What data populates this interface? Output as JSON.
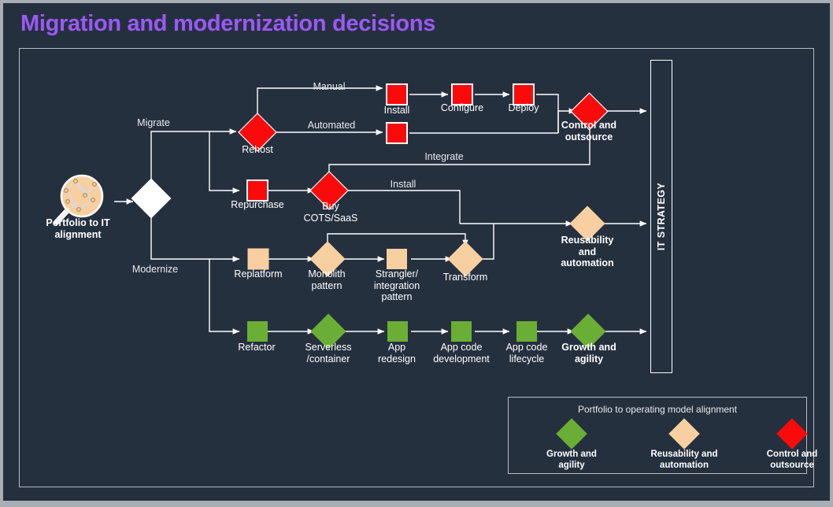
{
  "title": "Migration and modernization decisions",
  "colors": {
    "background": "#25303f",
    "page_border": "#a9adb4",
    "title": "#9b59f5",
    "red": "#fa0a0a",
    "green": "#6aae35",
    "peach": "#f8cfa1",
    "white": "#ffffff",
    "line": "#c9ccd1"
  },
  "start": {
    "icon": "magnifier-portfolio-icon",
    "label": "Portfolio to IT\nalignment"
  },
  "decision": {
    "name": "root-decision-diamond"
  },
  "edge_labels": {
    "migrate": "Migrate",
    "modernize": "Modernize",
    "manual": "Manual",
    "automated": "Automated",
    "integrate": "Integrate",
    "install_cots": "Install"
  },
  "nodes": {
    "rehost": {
      "label": "Rehost",
      "shape": "diamond",
      "color": "red"
    },
    "install": {
      "label": "Install",
      "shape": "square",
      "color": "red"
    },
    "configure": {
      "label": "Configure",
      "shape": "square",
      "color": "red"
    },
    "deploy": {
      "label": "Deploy",
      "shape": "square",
      "color": "red"
    },
    "automated_box": {
      "label": "",
      "shape": "square",
      "color": "red"
    },
    "control_outsource": {
      "label": "Control and\noutsource",
      "shape": "diamond",
      "color": "red",
      "bold": true
    },
    "repurchase": {
      "label": "Repurchase",
      "shape": "square",
      "color": "red"
    },
    "buy_cots": {
      "label": "Buy\nCOTS/SaaS",
      "shape": "diamond",
      "color": "red"
    },
    "replatform": {
      "label": "Replatform",
      "shape": "square",
      "color": "peach"
    },
    "monolith": {
      "label": "Monolith\npattern",
      "shape": "diamond",
      "color": "peach"
    },
    "strangler": {
      "label": "Strangler/\nintegration\npattern",
      "shape": "square",
      "color": "peach"
    },
    "transform": {
      "label": "Transform",
      "shape": "diamond",
      "color": "peach"
    },
    "reusability": {
      "label": "Reusability\nand\nautomation",
      "shape": "diamond",
      "color": "peach",
      "bold": true
    },
    "refactor": {
      "label": "Refactor",
      "shape": "square",
      "color": "green"
    },
    "serverless": {
      "label": "Serverless\n/container",
      "shape": "diamond",
      "color": "green"
    },
    "app_redesign": {
      "label": "App\nredesign",
      "shape": "square",
      "color": "green"
    },
    "app_code_dev": {
      "label": "App code\ndevelopment",
      "shape": "square",
      "color": "green"
    },
    "app_code_lifecycle": {
      "label": "App code\nlifecycle",
      "shape": "square",
      "color": "green"
    },
    "growth_agility": {
      "label": "Growth and\nagility",
      "shape": "diamond",
      "color": "green",
      "bold": true
    }
  },
  "strategy_bar": {
    "label": "IT STRATEGY"
  },
  "legend": {
    "title": "Portfolio  to operating model alignment",
    "items": [
      {
        "label": "Growth and\nagility",
        "color": "#6aae35",
        "name": "legend-growth-agility"
      },
      {
        "label": "Reusability and\nautomation",
        "color": "#f8cfa1",
        "name": "legend-reusability-automation"
      },
      {
        "label": "Control and\noutsource",
        "color": "#fa0a0a",
        "name": "legend-control-outsource"
      }
    ]
  }
}
